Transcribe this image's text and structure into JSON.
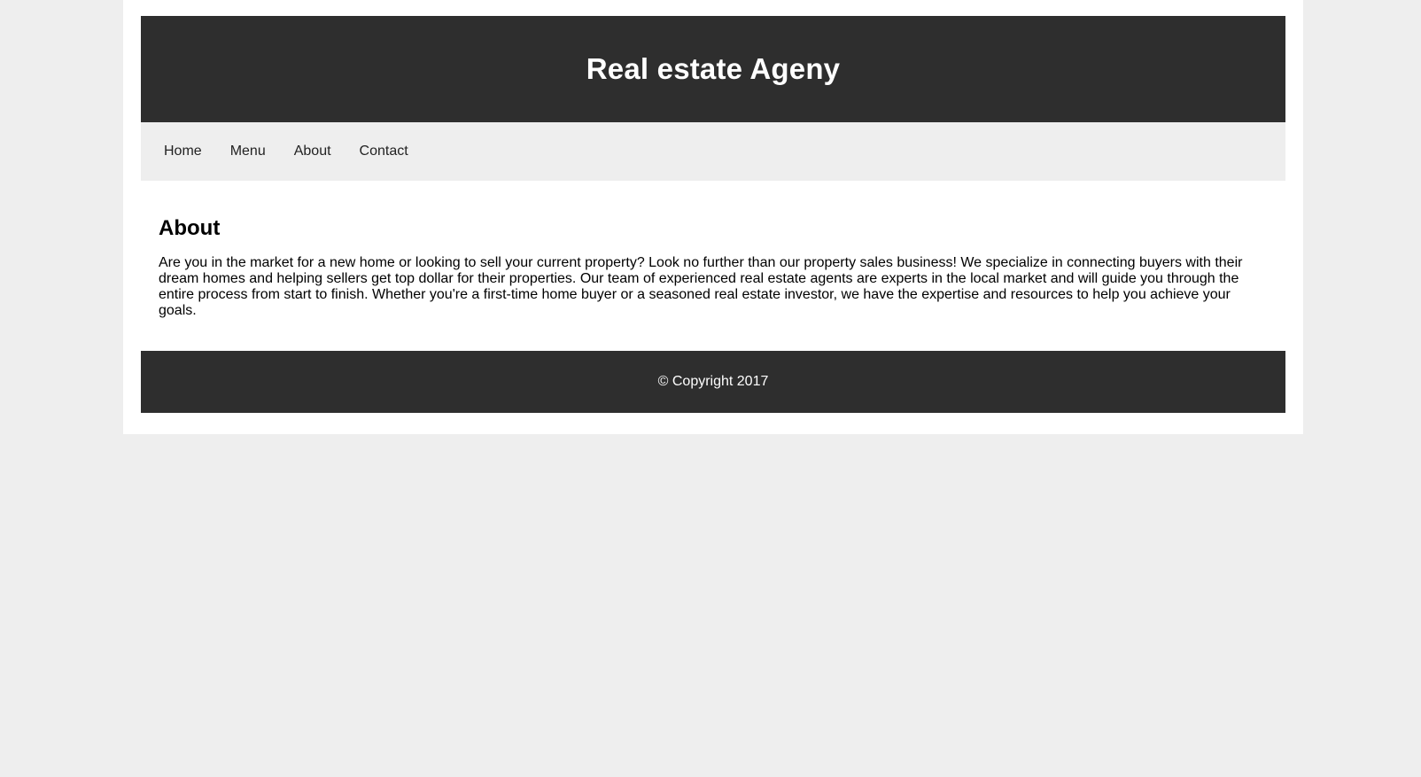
{
  "header": {
    "title": "Real estate Ageny"
  },
  "nav": {
    "items": [
      {
        "label": "Home"
      },
      {
        "label": "Menu"
      },
      {
        "label": "About"
      },
      {
        "label": "Contact"
      }
    ]
  },
  "main": {
    "heading": "About",
    "body": "Are you in the market for a new home or looking to sell your current property? Look no further than our property sales business! We specialize in connecting buyers with their dream homes and helping sellers get top dollar for their properties. Our team of experienced real estate agents are experts in the local market and will guide you through the entire process from start to finish. Whether you're a first-time home buyer or a seasoned real estate investor, we have the expertise and resources to help you achieve your goals."
  },
  "footer": {
    "copyright": "© Copyright 2017"
  },
  "colors": {
    "page_background": "#eeeeee",
    "container_background": "#ffffff",
    "header_background": "#2e2e2e",
    "nav_background": "#eeeeee",
    "footer_background": "#2e2e2e",
    "header_text": "#ffffff",
    "nav_text": "#222222"
  }
}
